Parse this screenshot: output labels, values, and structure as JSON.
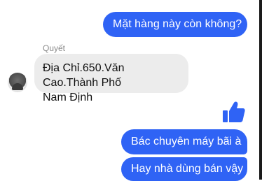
{
  "messages": {
    "outgoing_1": "Mặt hàng này còn không?",
    "sender_name": "Quyết",
    "incoming_1_line1": "Địa Chỉ.650.Văn Cao.Thành Phố",
    "incoming_1_line2": "Nam Định",
    "outgoing_2": "Bác chuyên máy bãi à",
    "outgoing_3": "Hay nhà dùng bán vậy"
  },
  "icons": {
    "like": "thumbs-up-icon",
    "avatar": "avatar"
  },
  "colors": {
    "outgoing_bubble": "#2f63f5",
    "incoming_bubble": "#ececec",
    "like_icon": "#2f63f5"
  }
}
